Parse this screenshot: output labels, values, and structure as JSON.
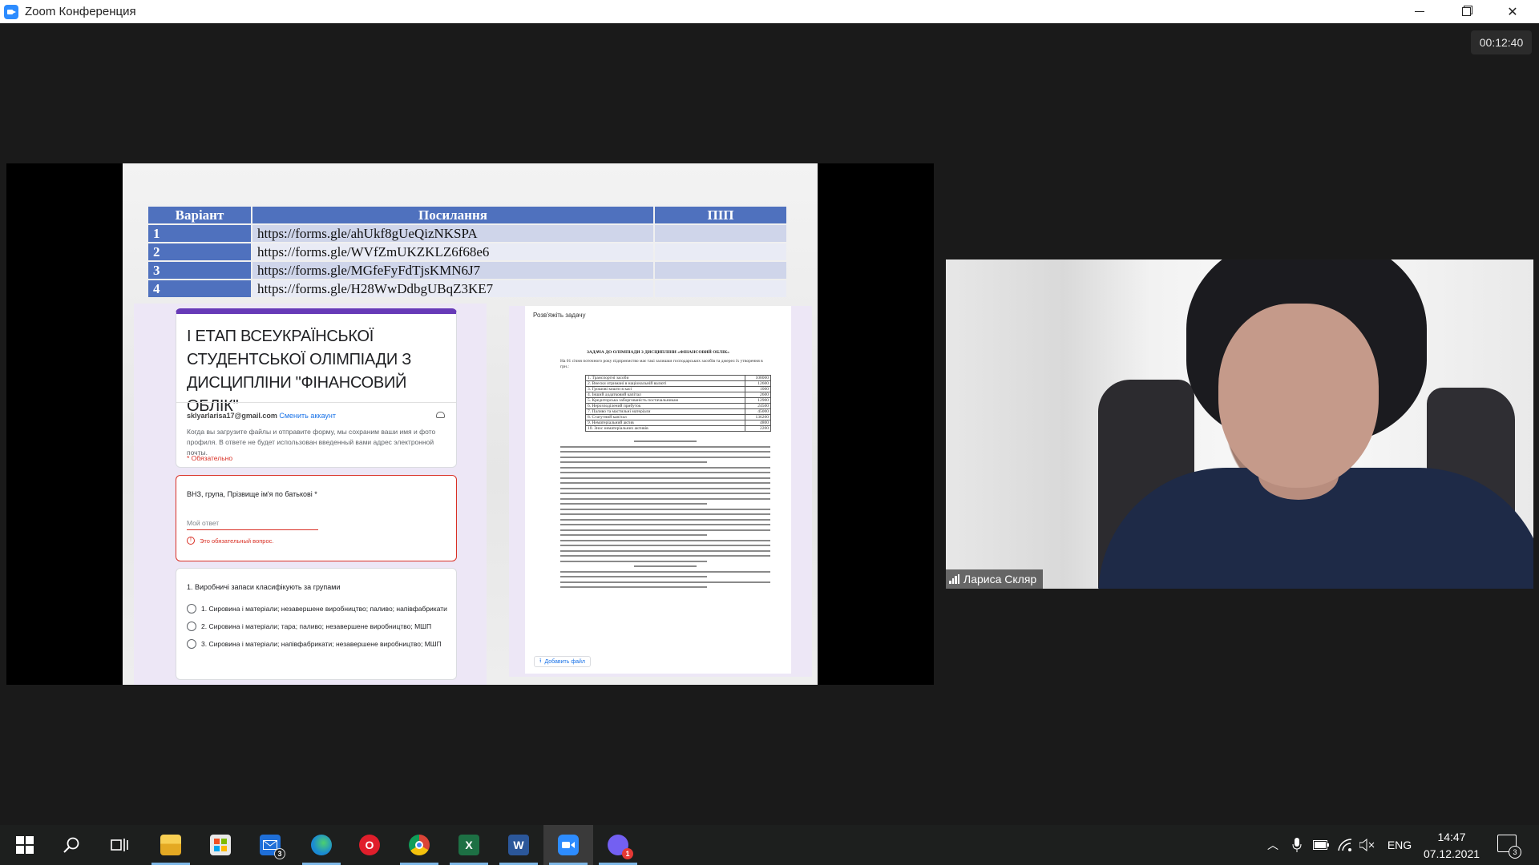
{
  "window": {
    "title": "Zoom Конференция",
    "timer": "00:12:40",
    "controls": {
      "minimize_icon": "minimize-icon",
      "restore_icon": "restore-icon",
      "close_glyph": "✕"
    }
  },
  "shared_slide": {
    "table": {
      "headers": [
        "Варіант",
        "Посилання",
        "ПІП"
      ],
      "rows": [
        {
          "num": "1",
          "link": "https://forms.gle/ahUkf8gUeQizNKSPA",
          "pib": ""
        },
        {
          "num": "2",
          "link": "https://forms.gle/WVfZmUKZKLZ6f68e6",
          "pib": ""
        },
        {
          "num": "3",
          "link": "https://forms.gle/MGfeFyFdTjsKMN6J7",
          "pib": ""
        },
        {
          "num": "4",
          "link": "https://forms.gle/H28WwDdbgUBqZ3KE7",
          "pib": ""
        }
      ]
    },
    "form": {
      "title": "І ЕТАП ВСЕУКРАЇНСЬКОЇ СТУДЕНТСЬКОЇ ОЛІМПІАДИ З ДИСЦИПЛІНИ \"ФІНАНСОВИЙ ОБЛІК\"",
      "email": "sklyarlarisa17@gmail.com",
      "switch_account": "Сменить аккаунт",
      "note": "Когда вы загрузите файлы и отправите форму, мы сохраним ваши имя и фото профиля. В ответе не будет использован введенный вами адрес электронной почты.",
      "required": "* Обязательно",
      "question1": {
        "label": "ВНЗ, група, Прізвище ім'я по батькові *",
        "placeholder": "Мой ответ",
        "error": "Это обязательный вопрос."
      },
      "question2": {
        "label": "1. Виробничі запаси класифікують за групами",
        "options": [
          "1. Сировина і матеріали; незавершене виробництво; паливо; напівфабрикати",
          "2. Сировина і матеріали; тара; паливо; незавершене виробництво; МШП",
          "3. Сировина і матеріали; напівфабрикати; незавершене виробництво; МШП"
        ]
      }
    },
    "document": {
      "top_label": "Розв'яжіть задачу",
      "title": "ЗАДАЧА ДО ОЛІМПІАДИ З ДИСЦИПЛІНИ «ФІНАНСОВИЙ ОБЛІК»",
      "intro": "На 01 січня поточного року підприємство має такі залишки господарських засобів та джерел їх утворення в грн.:",
      "items": [
        {
          "n": "1.",
          "name": "Транспортні засоби",
          "value": "108000"
        },
        {
          "n": "2.",
          "name": "Внески отримані в національній валюті",
          "value": "12600"
        },
        {
          "n": "3.",
          "name": "Грошові кошти в касі",
          "value": "1000"
        },
        {
          "n": "4.",
          "name": "Інший додатковий капітал",
          "value": "2600"
        },
        {
          "n": "5.",
          "name": "Кредиторська заборгованість постачальникам",
          "value": "12900"
        },
        {
          "n": "6.",
          "name": "Нерозподілений прибуток",
          "value": "24500"
        },
        {
          "n": "7.",
          "name": "Паливо та мастильні матеріали",
          "value": "45000"
        },
        {
          "n": "8.",
          "name": "Статутний капітал",
          "value": "136200"
        },
        {
          "n": "9.",
          "name": "Нематеріальний актив",
          "value": "4800"
        },
        {
          "n": "10.",
          "name": "Знос нематеріальних активів",
          "value": "2200"
        }
      ],
      "add_file": "Добавить файл"
    }
  },
  "participant": {
    "name": "Лариса Скляр"
  },
  "taskbar": {
    "apps": [
      {
        "name": "start-icon",
        "glyph": ""
      },
      {
        "name": "search-icon",
        "glyph": ""
      },
      {
        "name": "task-view-icon",
        "glyph": ""
      },
      {
        "name": "file-explorer-icon",
        "glyph": ""
      },
      {
        "name": "store-icon",
        "glyph": ""
      },
      {
        "name": "mail-icon",
        "glyph": "",
        "badge": "3"
      },
      {
        "name": "edge-icon",
        "glyph": ""
      },
      {
        "name": "opera-icon",
        "glyph": "O"
      },
      {
        "name": "chrome-icon",
        "glyph": ""
      },
      {
        "name": "excel-icon",
        "glyph": "X"
      },
      {
        "name": "word-icon",
        "glyph": "W"
      },
      {
        "name": "zoom-icon",
        "glyph": ""
      },
      {
        "name": "viber-icon",
        "glyph": "",
        "badge": "1"
      }
    ],
    "language": "ENG",
    "time": "14:47",
    "date": "07.12.2021",
    "notifications": "3"
  },
  "colors": {
    "accent_zoom": "#2d8cff",
    "table_header": "#4f71be",
    "form_purple": "#673ab7",
    "error_red": "#d93025"
  }
}
